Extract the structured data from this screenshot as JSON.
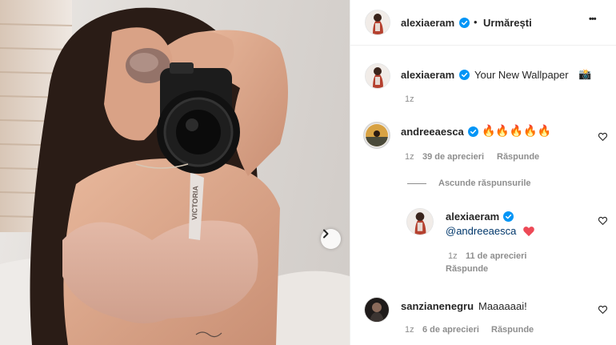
{
  "post": {
    "author": "alexiaeram",
    "follow_separator": "•",
    "follow_label": "Urmărești",
    "more_label": "•••"
  },
  "caption": {
    "username": "alexiaeram",
    "text": "Your New Wallpaper",
    "emoji": "📸",
    "time": "1z"
  },
  "comments": [
    {
      "username": "andreeaesca",
      "text": "🔥🔥🔥🔥🔥",
      "time": "1z",
      "likes": "39 de aprecieri",
      "reply_label": "Răspunde",
      "hide_replies": "Ascunde răspunsurile",
      "replies": [
        {
          "username": "alexiaeram",
          "mention": "@andreeaesca",
          "emoji": "❤️",
          "time": "1z",
          "likes": "11 de aprecieri",
          "reply_label": "Răspunde"
        }
      ]
    },
    {
      "username": "sanzianenegru",
      "text": "Maaaaaai!",
      "time": "1z",
      "likes": "6 de aprecieri",
      "reply_label": "Răspunde"
    }
  ],
  "photo_print": "VICTORIA",
  "colors": {
    "verified": "#0095f6",
    "heart_red": "#ed4956",
    "text": "#262626",
    "muted": "#8e8e8e",
    "link": "#00376b"
  },
  "icons": {
    "verified": "verified-badge-icon",
    "heart": "heart-outline-icon",
    "next": "chevron-right-icon",
    "more": "more-options-icon"
  }
}
